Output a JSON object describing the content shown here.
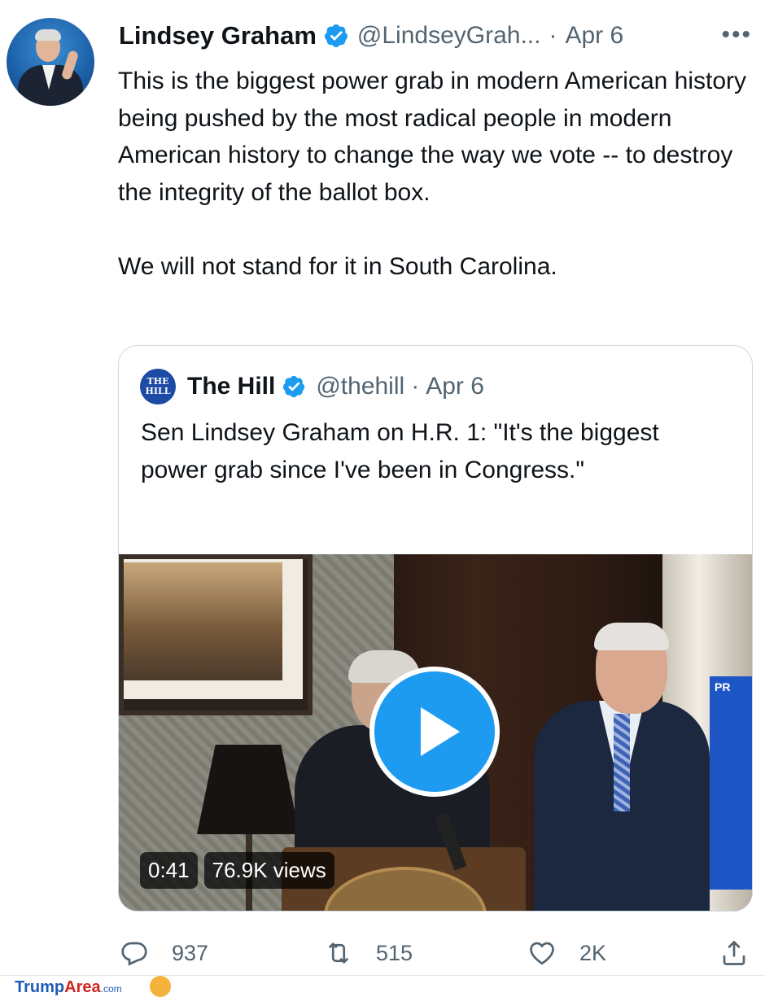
{
  "author": {
    "display_name": "Lindsey Graham",
    "handle": "@LindseyGrah...",
    "separator": "·",
    "date": "Apr 6",
    "verified": true,
    "more_icon": "more-horizontal-icon",
    "more_label": "•••"
  },
  "tweet": {
    "paragraphs": [
      "This is the biggest power grab in modern American history being pushed by the most radical people in modern American history to change the way we vote -- to destroy the integrity of the ballot box.",
      "We will not stand for it in South Carolina."
    ]
  },
  "quoted": {
    "avatar_text_line1": "THE",
    "avatar_text_line2": "HILL",
    "display_name": "The Hill",
    "handle": "@thehill",
    "separator": "·",
    "date": "Apr 6",
    "verified": true,
    "text": "Sen Lindsey Graham on H.R. 1: \"It's the biggest power grab since I've been in Congress.\"",
    "video": {
      "duration": "0:41",
      "views": "76.9K views",
      "play_icon": "play-icon",
      "sign_text": "PR"
    }
  },
  "actions": {
    "reply_count": "937",
    "retweet_count": "515",
    "like_count": "2K",
    "icons": [
      "reply-icon",
      "retweet-icon",
      "like-icon",
      "share-icon"
    ]
  },
  "watermark": {
    "part1": "Trump",
    "part2": "Area",
    "part3": ".com"
  },
  "colors": {
    "accent": "#1d9bf0",
    "text": "#0f1419",
    "secondary": "#536471",
    "border": "#cfd9de"
  }
}
